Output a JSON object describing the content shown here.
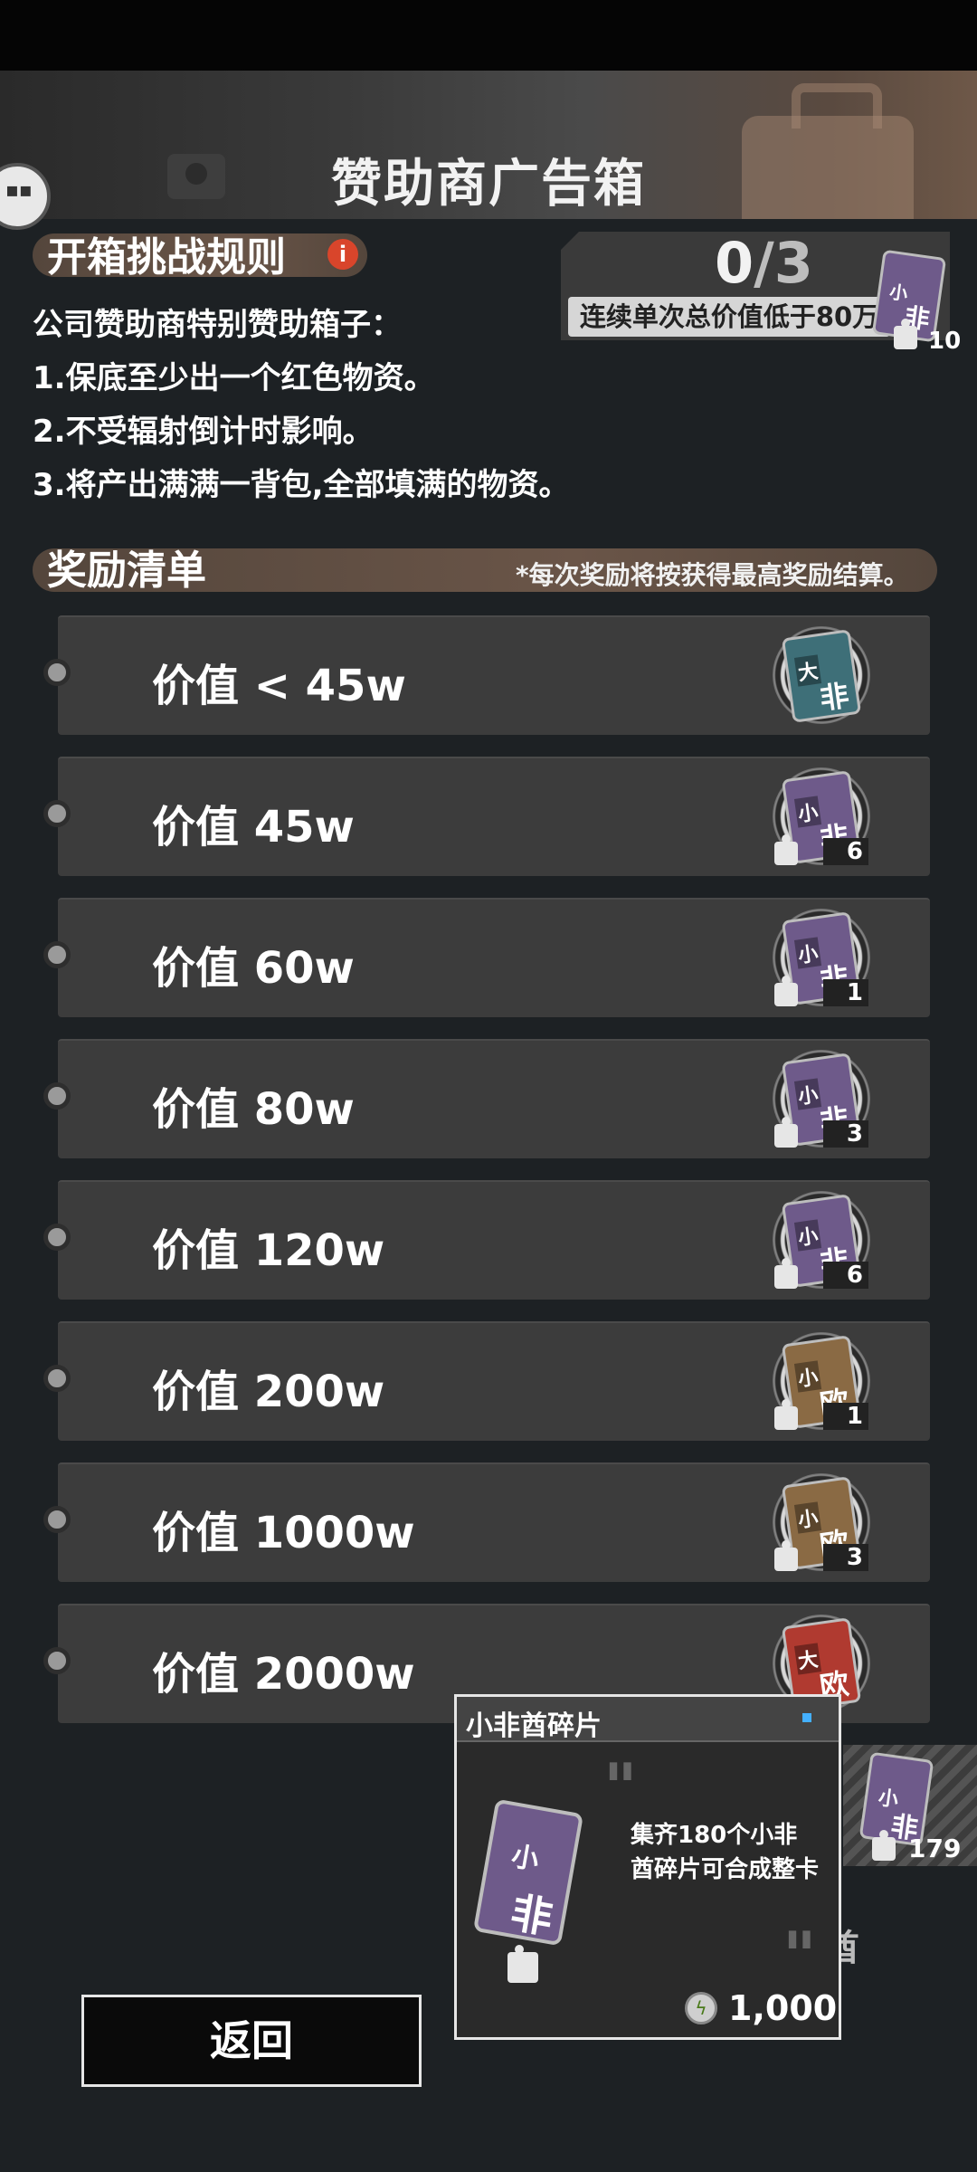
{
  "header": {
    "title": "赞助商广告箱"
  },
  "rules_section": {
    "title": "开箱挑战规则",
    "info_icon": "i",
    "lines": [
      "公司赞助商特别赞助箱子：",
      "1.保底至少出一个红色物资。",
      "2.不受辐射倒计时影响。",
      "3.将产出满满一背包,全部填满的物资。"
    ]
  },
  "challenge": {
    "current": "0",
    "separator": "/",
    "total": "3",
    "label": "连续单次总价值低于80万",
    "card_count": "10",
    "card_chars": [
      "小",
      "非"
    ]
  },
  "reward_section": {
    "title": "奖励清单",
    "note": "*每次奖励将按获得最高奖励结算。"
  },
  "rewards": [
    {
      "label": "价值 < 45w",
      "card": [
        "大",
        "非"
      ],
      "count": "",
      "color": "#3e6f78"
    },
    {
      "label": "价值 45w",
      "card": [
        "小",
        "非"
      ],
      "count": "6",
      "color": "#6e5a8a"
    },
    {
      "label": "价值 60w",
      "card": [
        "小",
        "非"
      ],
      "count": "1",
      "color": "#6e5a8a"
    },
    {
      "label": "价值 80w",
      "card": [
        "小",
        "非"
      ],
      "count": "3",
      "color": "#6e5a8a"
    },
    {
      "label": "价值 120w",
      "card": [
        "小",
        "非"
      ],
      "count": "6",
      "color": "#6e5a8a"
    },
    {
      "label": "价值 200w",
      "card": [
        "小",
        "欧"
      ],
      "count": "1",
      "color": "#8a6a44"
    },
    {
      "label": "价值 1000w",
      "card": [
        "小",
        "欧"
      ],
      "count": "3",
      "color": "#8a6a44"
    },
    {
      "label": "价值 2000w",
      "card": [
        "大",
        "欧"
      ],
      "count": "",
      "color": "#b03a30"
    }
  ],
  "tooltip": {
    "title": "小非酋碎片",
    "description": "集齐180个小非酋碎片可合成整卡",
    "price": "1,000",
    "card_chars": [
      "小",
      "非"
    ]
  },
  "side_item": {
    "count": "179",
    "card_chars": [
      "小",
      "非"
    ]
  },
  "partial_text": "酋",
  "back_button": {
    "label": "返回"
  }
}
